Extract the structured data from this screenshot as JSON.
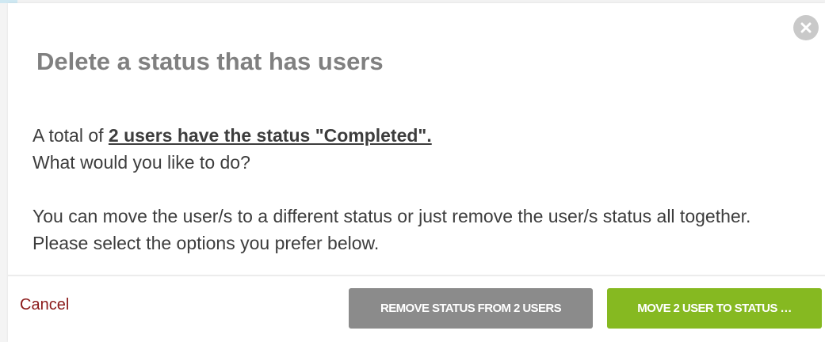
{
  "modal": {
    "title": "Delete a status that has users",
    "message": {
      "line1_prefix": "A total of ",
      "line1_link": "2 users have the status \"Completed\".",
      "line2": "What would you like to do?",
      "line3": "You can move the user/s to a different status or just remove the user/s status all together.",
      "line4": "Please select the options you prefer below."
    },
    "footer": {
      "cancel_label": "Cancel",
      "remove_button_label": "REMOVE STATUS FROM 2 USERS",
      "move_button_label": "MOVE 2 USER TO STATUS …"
    },
    "close_icon": "close-x"
  },
  "colors": {
    "title": "#808080",
    "text": "#3d3d3d",
    "cancel": "#8b1a1a",
    "remove_button": "#8b8b8b",
    "move_button": "#86b921",
    "close_button": "#c9c9c9"
  }
}
